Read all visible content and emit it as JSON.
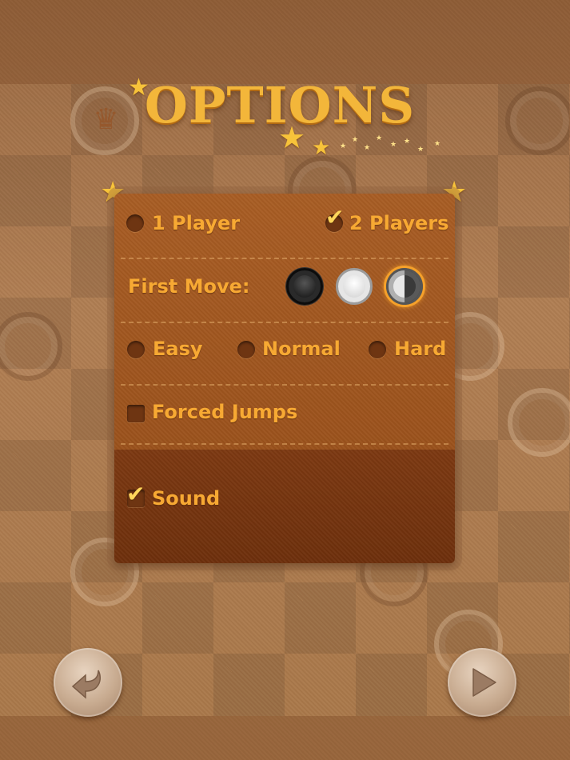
{
  "screen_title": "OPTIONS",
  "players": {
    "one_player_label": "1 Player",
    "two_players_label": "2 Players",
    "selected": "2 Players"
  },
  "first_move": {
    "label": "First Move:",
    "options": [
      "black-piece",
      "white-piece",
      "random-piece"
    ],
    "selected": "random-piece"
  },
  "difficulty": {
    "easy_label": "Easy",
    "normal_label": "Normal",
    "hard_label": "Hard",
    "selected": "none"
  },
  "forced_jumps": {
    "label": "Forced Jumps",
    "checked": false
  },
  "sound": {
    "label": "Sound",
    "checked": true
  },
  "nav": {
    "back_icon": "back-arrow-icon",
    "next_icon": "play-arrow-icon"
  },
  "colors": {
    "accent": "#f7a933",
    "panel": "#a85d24",
    "panel_dark": "#7d3912",
    "highlight": "#f6a12a"
  }
}
